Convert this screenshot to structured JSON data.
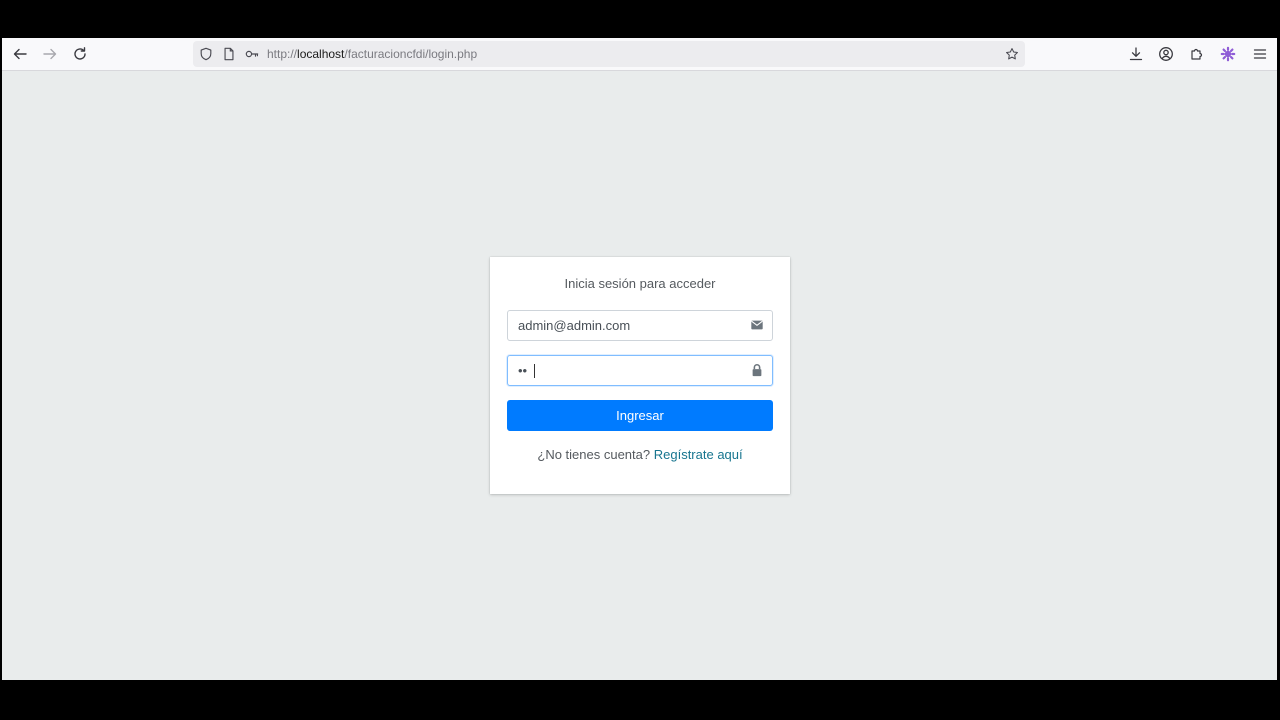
{
  "browser": {
    "url_prefix": "http://",
    "url_host": "localhost",
    "url_path": "/facturacioncfdi/login.php",
    "icons": {
      "back": "back-arrow-icon",
      "forward": "forward-arrow-icon",
      "reload": "reload-icon",
      "shield": "tracking-protection-shield-icon",
      "page": "page-info-icon",
      "key": "key-icon",
      "bookmark": "bookmark-star-icon",
      "downloads": "download-icon",
      "account": "account-icon",
      "extensions": "extensions-puzzle-icon",
      "extension_app": "extension-gear-icon",
      "menu": "hamburger-menu-icon"
    },
    "accent_extension_color": "#8f5cd6"
  },
  "login": {
    "message": "Inicia sesión para acceder",
    "email_value": "admin@admin.com",
    "email_icon": "envelope-icon",
    "password_value": "••",
    "password_icon": "lock-icon",
    "submit_label": "Ingresar",
    "no_account_text": "¿No tienes cuenta?",
    "register_link": "Regístrate aquí"
  },
  "colors": {
    "page_background": "#e9ecec",
    "primary_button": "#007bff",
    "link": "#17758f"
  }
}
